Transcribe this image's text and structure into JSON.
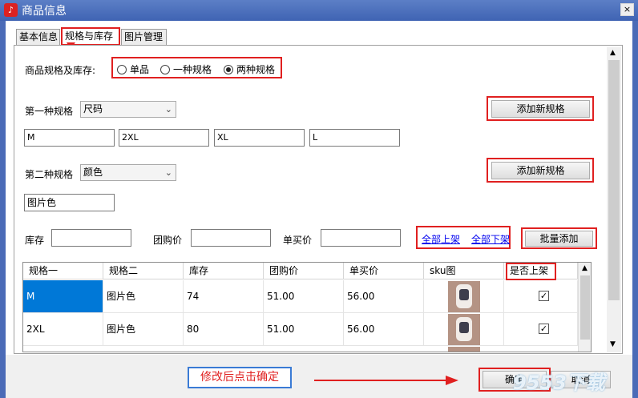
{
  "window": {
    "title": "商品信息",
    "close_label": "×",
    "app_icon_glyph": "♪"
  },
  "tabs": [
    {
      "label": "基本信息"
    },
    {
      "label": "规格与库存"
    },
    {
      "label": "图片管理"
    }
  ],
  "spec_mode": {
    "label": "商品规格及库存:",
    "options": [
      {
        "label": "单品"
      },
      {
        "label": "一种规格"
      },
      {
        "label": "两种规格"
      }
    ],
    "selected": "两种规格"
  },
  "spec1": {
    "label": "第一种规格",
    "selected": "尺码",
    "values": [
      "M",
      "2XL",
      "XL",
      "L"
    ],
    "add_button": "添加新规格"
  },
  "spec2": {
    "label": "第二种规格",
    "selected": "颜色",
    "values": [
      "图片色"
    ],
    "add_button": "添加新规格"
  },
  "pricing": {
    "stock_label": "库存",
    "stock_value": "",
    "group_price_label": "团购价",
    "group_price_value": "",
    "single_price_label": "单买价",
    "single_price_value": "",
    "all_on_shelf": "全部上架",
    "all_off_shelf": "全部下架",
    "batch_add": "批量添加"
  },
  "table": {
    "columns": [
      "规格一",
      "规格二",
      "库存",
      "团购价",
      "单买价",
      "sku图",
      "是否上架"
    ],
    "rows": [
      {
        "spec1": "M",
        "spec2": "图片色",
        "stock": "74",
        "group_price": "51.00",
        "single_price": "56.00",
        "on_shelf": "✓"
      },
      {
        "spec1": "2XL",
        "spec2": "图片色",
        "stock": "80",
        "group_price": "51.00",
        "single_price": "56.00",
        "on_shelf": "✓"
      }
    ]
  },
  "annotation": {
    "text": "修改后点击确定"
  },
  "footer": {
    "ok": "确定",
    "cancel": "取消"
  },
  "watermark": {
    "text": "9553下载"
  },
  "colors": {
    "highlight_red": "#e02020",
    "selection_blue": "#0078d7",
    "annotation_blue": "#3a7bd5"
  }
}
